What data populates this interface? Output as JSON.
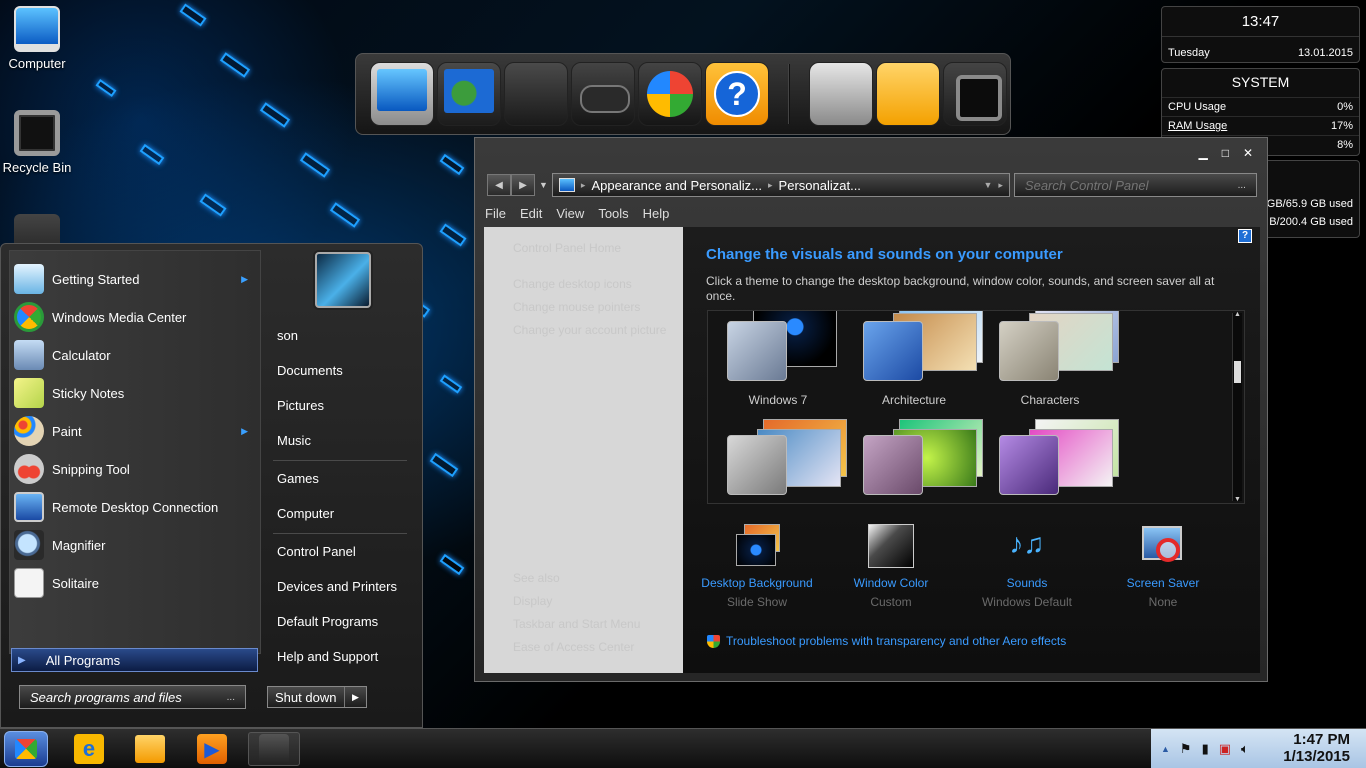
{
  "desktop": {
    "icons": [
      {
        "label": "Computer"
      },
      {
        "label": "Recycle Bin"
      }
    ]
  },
  "gadgets": {
    "clock": {
      "time": "13:47",
      "day": "Tuesday",
      "date": "13.01.2015"
    },
    "system": {
      "title": "SYSTEM",
      "cpu_label": "CPU Usage",
      "cpu_value": "0%",
      "ram_label": "RAM Usage",
      "ram_value": "17%",
      "third_value": "8%"
    },
    "disks": {
      "disk1": "GB/65.9 GB used",
      "disk2": "B/200.4 GB used"
    }
  },
  "window": {
    "breadcrumb": [
      "Appearance and Personaliz...",
      "Personalizat..."
    ],
    "search_placeholder": "Search Control Panel",
    "menu": [
      "File",
      "Edit",
      "View",
      "Tools",
      "Help"
    ],
    "left_links": {
      "home": "Control Panel Home",
      "desktop_icons": "Change desktop icons",
      "mouse_pointers": "Change mouse pointers",
      "account_picture": "Change your account picture",
      "see_also": "See also",
      "display": "Display",
      "taskbar": "Taskbar and Start Menu",
      "ease": "Ease of Access Center"
    },
    "title": "Change the visuals and sounds on your computer",
    "description": "Click a theme to change the desktop background, window color, sounds, and screen saver all at once.",
    "themes": [
      "Windows 7",
      "Architecture",
      "Characters"
    ],
    "bottom": [
      {
        "link": "Desktop Background",
        "sub": "Slide Show"
      },
      {
        "link": "Window Color",
        "sub": "Custom"
      },
      {
        "link": "Sounds",
        "sub": "Windows Default"
      },
      {
        "link": "Screen Saver",
        "sub": "None"
      }
    ],
    "troubleshoot": "Troubleshoot problems with transparency and other Aero effects"
  },
  "start_menu": {
    "programs": [
      "Getting Started",
      "Windows Media Center",
      "Calculator",
      "Sticky Notes",
      "Paint",
      "Snipping Tool",
      "Remote Desktop Connection",
      "Magnifier",
      "Solitaire"
    ],
    "all_programs": "All Programs",
    "search_placeholder": "Search programs and files",
    "right": {
      "user": "son",
      "documents": "Documents",
      "pictures": "Pictures",
      "music": "Music",
      "games": "Games",
      "computer": "Computer",
      "control_panel": "Control Panel",
      "devices": "Devices and Printers",
      "default_programs": "Default Programs",
      "help": "Help and Support"
    },
    "shutdown": "Shut down"
  },
  "taskbar": {
    "time": "1:47 PM",
    "date": "1/13/2015"
  },
  "colors": {
    "link_blue": "#3a9bff",
    "wallpaper_glow": "#1ea0ff",
    "tray_bg": "#c4d8ee"
  }
}
